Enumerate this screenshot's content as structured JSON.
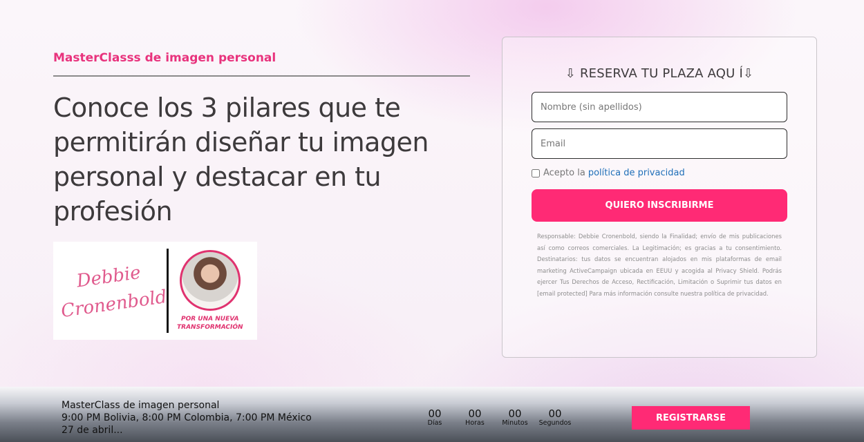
{
  "hero": {
    "eyebrow": "MasterClasss de imagen personal",
    "headline": "Conoce los 3 pilares que te permitirán diseñar tu imagen personal y destacar en tu profesión"
  },
  "brand": {
    "signature": "Debbie Cronenbold",
    "tagline_line1": "POR UNA NUEVA",
    "tagline_line2": "TRANSFORMACIÓN"
  },
  "form": {
    "title": "⇩ RESERVA TU PLAZA AQU Í⇩",
    "name_placeholder": "Nombre (sin apellidos)",
    "email_placeholder": "Email",
    "consent_text": "Acepto la",
    "consent_link": "política de privacidad",
    "submit_label": "QUIERO INSCRIBIRME",
    "legal_text": "Responsable: Debbie Cronenbold, siendo la Finalidad; envío de mis publicaciones así como correos comerciales. La Legitimación; es gracias a tu consentimiento. Destinatarios: tus datos se encuentran alojados en mis plataformas de email marketing ActiveCampaign ubicada en EEUU y acogida al Privacy Shield. Podrás ejercer Tus Derechos de Acceso, Rectificación, Limitación o Suprimir tus datos en [email protected] Para más información consulte nuestra política de privacidad."
  },
  "bar": {
    "title": "MasterClass de imagen personal",
    "times": "9:00 PM Bolivia, 8:00 PM Colombia, 7:00 PM México",
    "date": "27 de abril...",
    "countdown": [
      {
        "value": "00",
        "label": "Días"
      },
      {
        "value": "00",
        "label": "Horas"
      },
      {
        "value": "00",
        "label": "Minutos"
      },
      {
        "value": "00",
        "label": "Segundos"
      }
    ],
    "button_label": "REGISTRARSE"
  },
  "colors": {
    "accent": "#ff2a75",
    "eyebrow": "#e8337d",
    "link": "#1f6fb8"
  }
}
